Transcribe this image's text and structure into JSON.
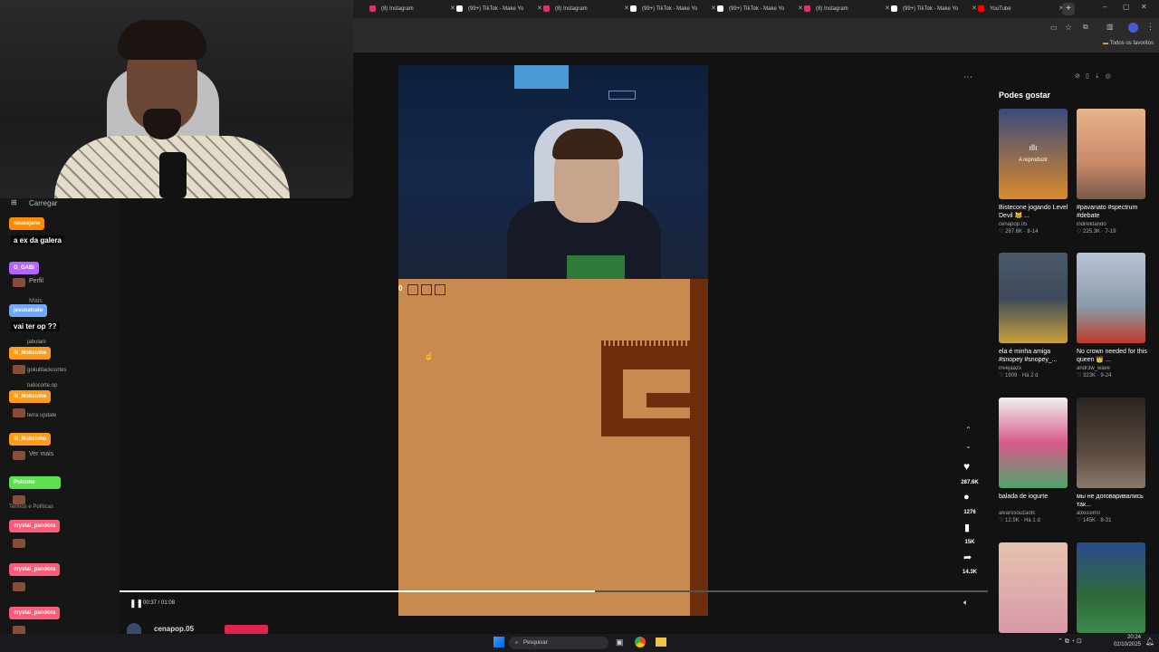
{
  "browser": {
    "tabs": [
      {
        "label": "(8) Instagram",
        "icon": "instagram-icon",
        "color": "#e1306c"
      },
      {
        "label": "(99+) TikTok - Make Yo",
        "icon": "tiktok-icon",
        "color": "#ffffff"
      },
      {
        "label": "(8) Instagram",
        "icon": "instagram-icon",
        "color": "#e1306c"
      },
      {
        "label": "(99+) TikTok - Make Yo",
        "icon": "tiktok-icon",
        "color": "#ffffff"
      },
      {
        "label": "(99+) TikTok - Make Yo",
        "icon": "tiktok-icon",
        "color": "#ffffff"
      },
      {
        "label": "(8) Instagram",
        "icon": "instagram-icon",
        "color": "#e1306c"
      },
      {
        "label": "(99+) TikTok - Make Yo",
        "icon": "tiktok-icon",
        "color": "#ffffff"
      },
      {
        "label": "YouTube",
        "icon": "youtube-icon",
        "color": "#ff0000"
      }
    ],
    "bookmarks_label": "Todos os favoritos"
  },
  "sidebar": {
    "upload_label": "Carregar",
    "profile_label": "Perfil",
    "more_label": "Mais",
    "accounts": [
      "jabulani",
      "gokublackcortes",
      "tudocorte.op",
      "terra update",
      "Ver mais"
    ],
    "footer": "Termos e Políticas"
  },
  "chat": [
    {
      "user": "neuesjane",
      "color": "#ff8c00",
      "msg": "a ex da galera"
    },
    {
      "user": "G_GABI",
      "color": "#b565ff",
      "msg": ""
    },
    {
      "user": "jesusalcalo",
      "color": "#6fa8ff",
      "msg": "vai ter op ??"
    },
    {
      "user": "lil_Mobzinho",
      "color": "#ff9a1a",
      "msg": ""
    },
    {
      "user": "lil_Mobzinho",
      "color": "#ff9a1a",
      "msg": ""
    },
    {
      "user": "lil_Mobzinho",
      "color": "#ff9a1a",
      "msg": ""
    },
    {
      "user": "Pokinho",
      "color": "#5ee04f",
      "msg": ""
    },
    {
      "user": "crystal_pandora",
      "color": "#ff5c7a",
      "msg": ""
    },
    {
      "user": "crystal_pandora",
      "color": "#ff5c7a",
      "msg": ""
    },
    {
      "user": "crystal_pandora",
      "color": "#ff5c7a",
      "msg": ""
    }
  ],
  "video": {
    "time": "00:37 / 01:08",
    "progress": 0.547,
    "author": "cenapop.05",
    "likes": "287.6K",
    "comments": "1276",
    "saves": "15K",
    "shares": "14.3K",
    "game_counter": "0"
  },
  "suggestions": {
    "title": "Podes gostar",
    "playing_label": "A reproduzir",
    "items": [
      {
        "caption": "Bistecone jogando Level Devil 😹 ...",
        "author": "cenapop.05",
        "likes": "287.6K",
        "date": "8-14",
        "color": "#d98a2c"
      },
      {
        "caption": "#pavanato #spectrum #debate",
        "author": "indirektando",
        "likes": "225.3K",
        "date": "7-19",
        "color": "#e8b38a"
      },
      {
        "caption": "ela é minha amiga #snopey #snopey_...",
        "author": "invejaazx",
        "likes": "1909",
        "date": "Há 2 d",
        "color": "#3e4a5a"
      },
      {
        "caption": "No crown needed for this queen 👑 ...",
        "author": "andr3w_wave",
        "likes": "323K",
        "date": "9-24",
        "color": "#b8c4d6"
      },
      {
        "caption": "balada de iogurte",
        "author": "alvarosouzaofc",
        "likes": "12.5K",
        "date": "Há 1 d",
        "color": "#4fa36a"
      },
      {
        "caption": "мы не договаривались так...",
        "author": "allxissim0",
        "likes": "145K",
        "date": "8-31",
        "color": "#5a4a3e"
      },
      {
        "caption": "",
        "author": "",
        "likes": "",
        "date": "",
        "color": "#e6c2b0"
      },
      {
        "caption": "",
        "author": "",
        "likes": "",
        "date": "",
        "color": "#2f6a3a"
      }
    ]
  },
  "taskbar": {
    "search_placeholder": "Pesquisar",
    "time": "20:24",
    "date": "02/10/2025"
  }
}
